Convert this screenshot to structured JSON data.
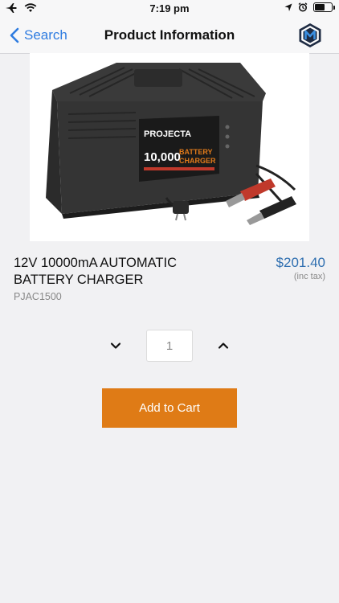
{
  "status_bar": {
    "time": "7:19 pm",
    "icons": [
      "airplane-icon",
      "wifi-icon",
      "location-icon",
      "alarm-icon",
      "battery-icon"
    ]
  },
  "nav": {
    "back_label": "Search",
    "title": "Product Information",
    "logo_icon": "brand-logo-m-icon"
  },
  "product": {
    "image_alt": "battery-charger-product-image",
    "image_text": {
      "brand": "PROJECTA",
      "capacity": "10,000",
      "type": "BATTERY",
      "type2": "CHARGER"
    },
    "name": "12V 10000mA AUTOMATIC BATTERY CHARGER",
    "sku": "PJAC1500",
    "price": "$201.40",
    "price_note": "(inc tax)"
  },
  "quantity": {
    "value": "1",
    "decrease_icon": "chevron-down-icon",
    "increase_icon": "chevron-up-icon"
  },
  "cart": {
    "add_label": "Add to Cart"
  },
  "colors": {
    "accent_blue": "#2f7ce0",
    "price_blue": "#2f6fb0",
    "button_orange": "#df7b16",
    "background": "#f1f1f3"
  }
}
